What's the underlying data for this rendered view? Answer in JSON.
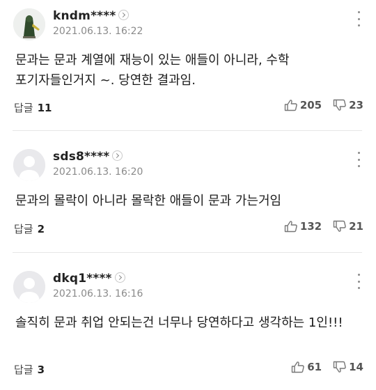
{
  "reply_label": "답글",
  "comments": [
    {
      "username": "kndm****",
      "timestamp": "2021.06.13. 16:22",
      "text": "문과는 문과 계열에 재능이 있는 애들이 아니라, 수학 포기자들인거지 ~. 당연한 결과임.",
      "reply_count": "11",
      "likes": "205",
      "dislikes": "23",
      "avatar": "custom"
    },
    {
      "username": "sds8****",
      "timestamp": "2021.06.13. 16:20",
      "text": "문과의 몰락이 아니라 몰락한 애들이 문과 가는거임",
      "reply_count": "2",
      "likes": "132",
      "dislikes": "21",
      "avatar": "default"
    },
    {
      "username": "dkq1****",
      "timestamp": "2021.06.13. 16:16",
      "text": "솔직히 문과 취업 안되는건 너무나 당연하다고 생각하는 1인!!!",
      "reply_count": "3",
      "likes": "61",
      "dislikes": "14",
      "avatar": "default"
    }
  ]
}
